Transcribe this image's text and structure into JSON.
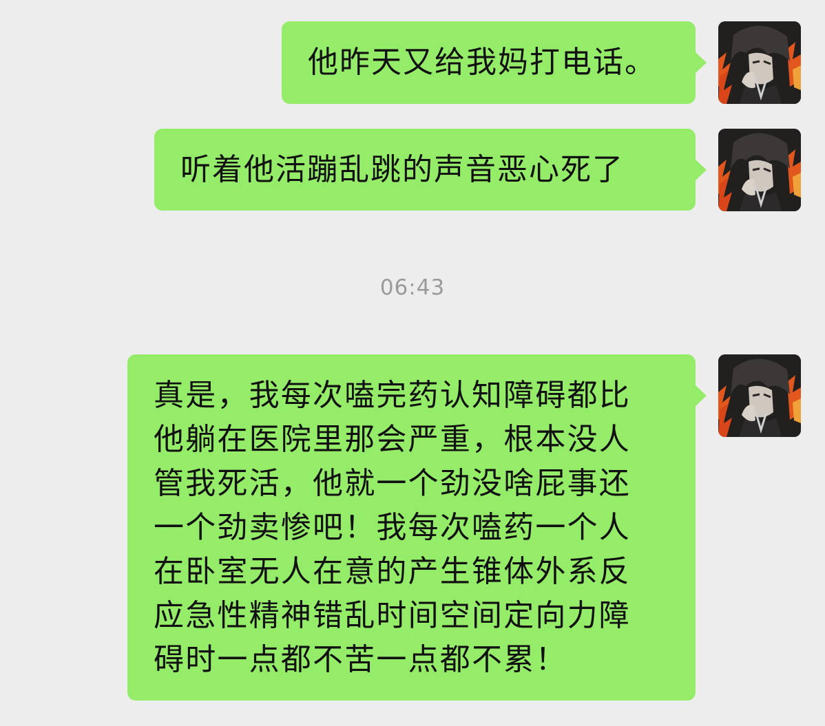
{
  "messages": [
    {
      "sender": "me",
      "text": "他昨天又给我妈打电话。"
    },
    {
      "sender": "me",
      "text": "听着他活蹦乱跳的声音恶心死了"
    },
    {
      "sender": "me",
      "text": "真是，我每次嗑完药认知障碍都比\n他躺在医院里那会严重，根本没人\n管我死活，他就一个劲没啥屁事还\n一个劲卖惨吧！我每次嗑药一个人\n在卧室无人在意的产生锥体外系反\n应急性精神错乱时间空间定向力障\n碍时一点都不苦一点都不累！"
    }
  ],
  "timestamp": "06:43",
  "colors": {
    "background": "#ededed",
    "bubble_self": "#95ec69",
    "timestamp_text": "#9a9a9a"
  },
  "icons": {
    "avatar": "user-avatar-illustration"
  }
}
